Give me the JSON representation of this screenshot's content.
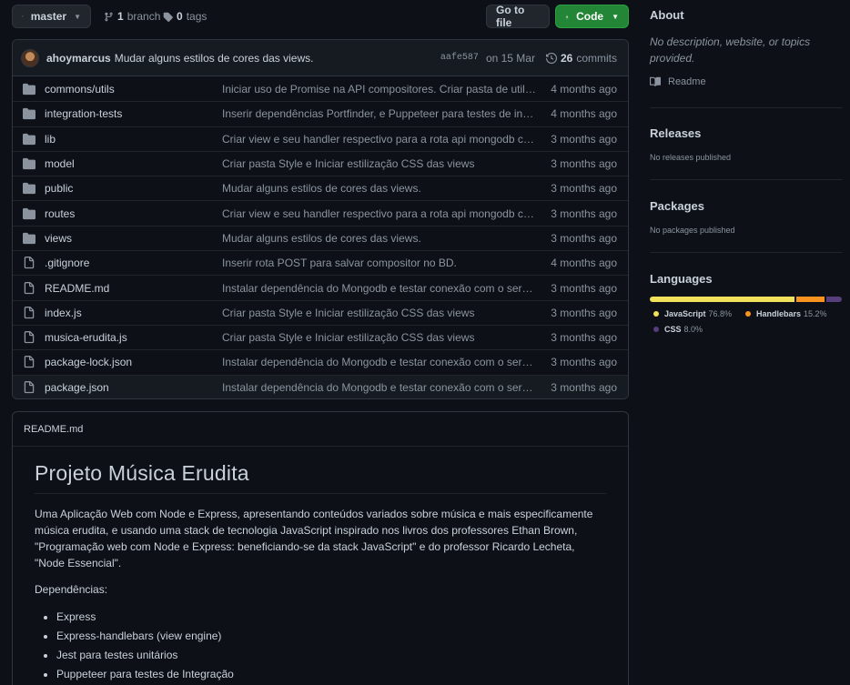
{
  "toolbar": {
    "branch": "master",
    "branch_count": "1",
    "branch_label": "branch",
    "tag_count": "0",
    "tag_label": "tags",
    "goto_file": "Go to file",
    "code": "Code"
  },
  "commit": {
    "author": "ahoymarcus",
    "message": "Mudar alguns estilos de cores das views.",
    "sha": "aafe587",
    "date": "on 15 Mar",
    "count": "26",
    "count_label": "commits"
  },
  "files": [
    {
      "type": "dir",
      "name": "commons/utils",
      "message": "Iniciar uso de Promise na API compositores. Criar pasta de utilitário…",
      "age": "4 months ago"
    },
    {
      "type": "dir",
      "name": "integration-tests",
      "message": "Inserir dependências Portfinder, e Puppeteer para testes de integraçã…",
      "age": "4 months ago"
    },
    {
      "type": "dir",
      "name": "lib",
      "message": "Criar view e seu handler respectivo para a rota api mongodb composito…",
      "age": "3 months ago"
    },
    {
      "type": "dir",
      "name": "model",
      "message": "Criar pasta Style e Iniciar estilização CSS das views",
      "age": "3 months ago"
    },
    {
      "type": "dir",
      "name": "public",
      "message": "Mudar alguns estilos de cores das views.",
      "age": "3 months ago"
    },
    {
      "type": "dir",
      "name": "routes",
      "message": "Criar view e seu handler respectivo para a rota api mongodb composito…",
      "age": "3 months ago"
    },
    {
      "type": "dir",
      "name": "views",
      "message": "Mudar alguns estilos de cores das views.",
      "age": "3 months ago"
    },
    {
      "type": "file",
      "name": ".gitignore",
      "message": "Inserir rota POST para salvar compositor no BD.",
      "age": "4 months ago"
    },
    {
      "type": "file",
      "name": "README.md",
      "message": "Instalar dependência do Mongodb e testar conexão com o servidor de b…",
      "age": "3 months ago"
    },
    {
      "type": "file",
      "name": "index.js",
      "message": "Criar pasta Style e Iniciar estilização CSS das views",
      "age": "3 months ago"
    },
    {
      "type": "file",
      "name": "musica-erudita.js",
      "message": "Criar pasta Style e Iniciar estilização CSS das views",
      "age": "3 months ago"
    },
    {
      "type": "file",
      "name": "package-lock.json",
      "message": "Instalar dependência do Mongodb e testar conexão com o servidor de b…",
      "age": "3 months ago"
    },
    {
      "type": "file",
      "name": "package.json",
      "message": "Instalar dependência do Mongodb e testar conexão com o servidor de b…",
      "age": "3 months ago"
    }
  ],
  "readme": {
    "filename": "README.md",
    "title": "Projeto Música Erudita",
    "paragraph": "Uma Aplicação Web com Node e Express, apresentando conteúdos variados sobre música e mais especificamente música erudita, e usando uma stack de tecnologia JavaScript inspirado nos livros dos professores Ethan Brown, \"Programação web com Node e Express: beneficiando-se da stack JavaScript\" e do professor Ricardo Lecheta, \"Node Essencial\".",
    "deps_label": "Dependências:",
    "deps": [
      "Express",
      "Express-handlebars (view engine)",
      "Jest para testes unitários",
      "Puppeteer para testes de Integração"
    ]
  },
  "sidebar": {
    "about_title": "About",
    "about_text": "No description, website, or topics provided.",
    "readme_link": "Readme",
    "releases_title": "Releases",
    "releases_text": "No releases published",
    "packages_title": "Packages",
    "packages_text": "No packages published",
    "languages_title": "Languages",
    "languages": [
      {
        "name": "JavaScript",
        "percent": "76.8%",
        "value": 76.8,
        "color": "#f1e05a"
      },
      {
        "name": "Handlebars",
        "percent": "15.2%",
        "value": 15.2,
        "color": "#f7931e"
      },
      {
        "name": "CSS",
        "percent": "8.0%",
        "value": 8.0,
        "color": "#563d7c"
      }
    ]
  }
}
